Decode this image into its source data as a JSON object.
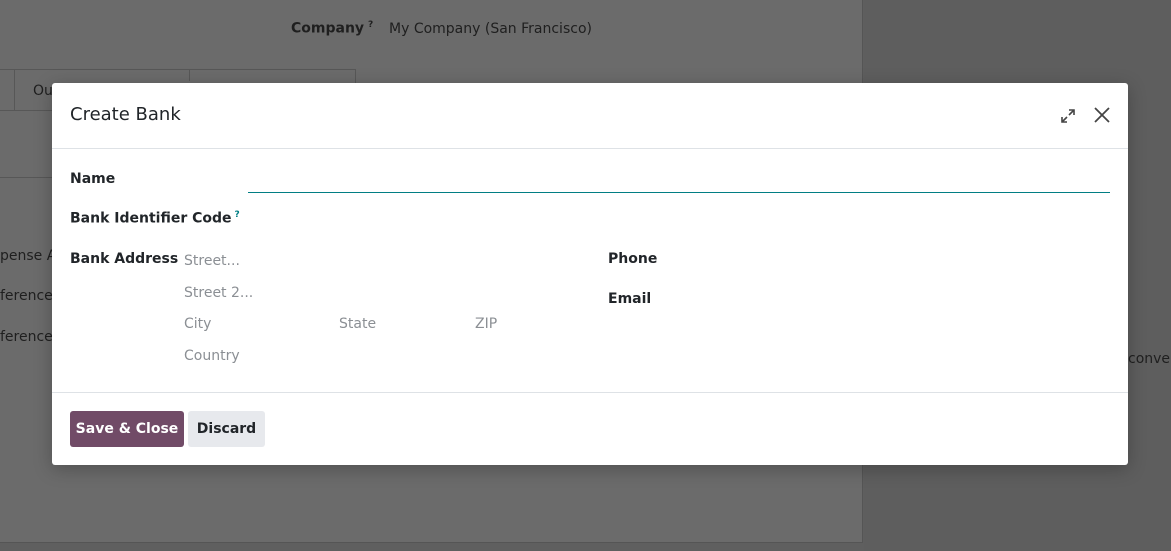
{
  "background": {
    "company_label": "Company",
    "company_help": "?",
    "company_value": "My Company (San Francisco)",
    "tab_fragment": "Ou",
    "left_fragments": [
      "pense A",
      "ference",
      "ference"
    ],
    "right_fragment": "conver"
  },
  "modal": {
    "title": "Create Bank",
    "icons": {
      "expand": "expand-icon",
      "close": "close-icon"
    },
    "fields": {
      "name_label": "Name",
      "name_value": "",
      "bic_label": "Bank Identifier Code",
      "bic_help": "?",
      "address_label": "Bank Address",
      "street_placeholder": "Street...",
      "street2_placeholder": "Street 2...",
      "city_placeholder": "City",
      "state_placeholder": "State",
      "zip_placeholder": "ZIP",
      "country_placeholder": "Country",
      "phone_label": "Phone",
      "email_label": "Email"
    },
    "footer": {
      "save_label": "Save & Close",
      "discard_label": "Discard"
    }
  },
  "colors": {
    "primary": "#714b67",
    "accent": "#017e84",
    "secondary_button": "#e7e9ed"
  }
}
